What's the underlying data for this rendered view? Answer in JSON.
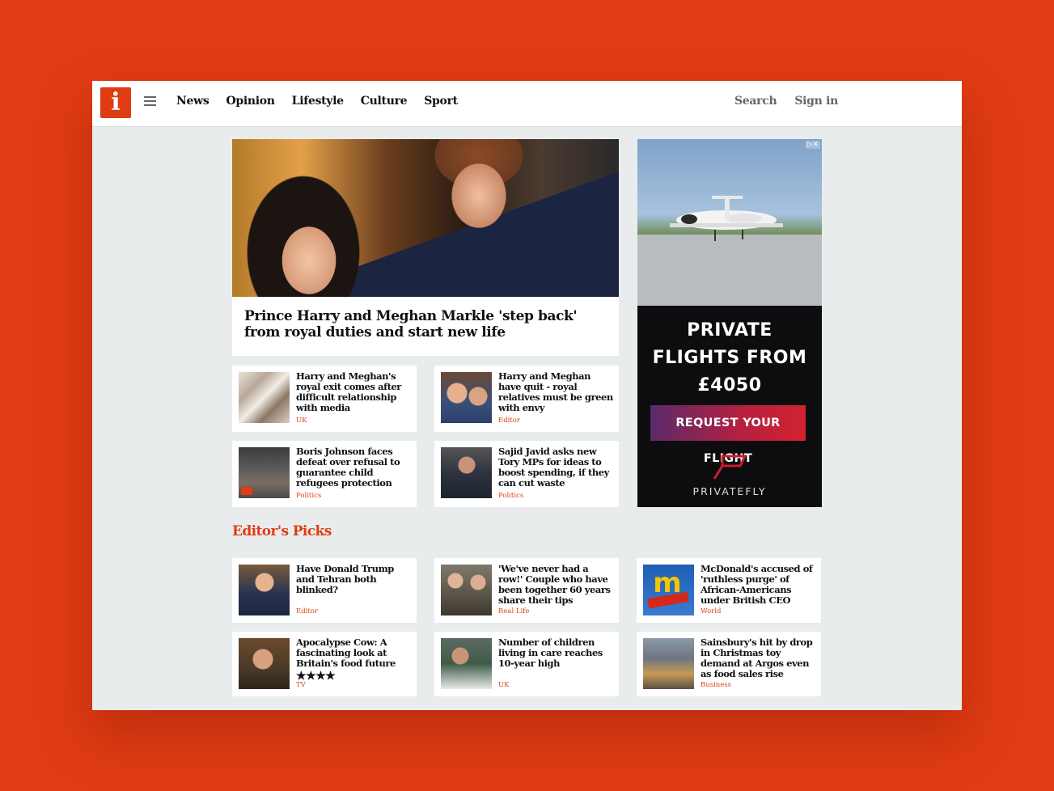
{
  "logo": "i",
  "nav": [
    "News",
    "Opinion",
    "Lifestyle",
    "Culture",
    "Sport"
  ],
  "topright": {
    "search": "Search",
    "signin": "Sign in"
  },
  "hero": {
    "title": "Prince Harry and Meghan Markle 'step back' from royal duties and start new life"
  },
  "stories": [
    {
      "title": "Harry and Meghan's royal exit comes after difficult relationship with media",
      "tag": "UK",
      "icon": "newspapers-thumbnail"
    },
    {
      "title": "Harry and Meghan have quit - royal relatives must be green with envy",
      "tag": "Editor",
      "icon": "royal-couple-thumbnail"
    },
    {
      "title": "Boris Johnson faces defeat over refusal to guarantee child refugees protection",
      "tag": "Politics",
      "icon": "protest-video-thumbnail"
    },
    {
      "title": "Sajid Javid asks new Tory MPs for ideas to boost spending, if they can cut waste",
      "tag": "Politics",
      "icon": "minister-thumbnail"
    }
  ],
  "ad": {
    "marks": "▷✕",
    "headline": [
      "PRIVATE",
      "FLIGHTS FROM",
      "£4050"
    ],
    "button": "REQUEST YOUR FLIGHT",
    "brand": "PRIVATEFLY"
  },
  "editors_picks": {
    "title": "Editor's Picks",
    "items": [
      {
        "title": "Have Donald Trump and Tehran both blinked?",
        "tag": "Editor"
      },
      {
        "title": "'We've never had a row!' Couple who have been together 60 years share their tips",
        "tag": "Real Life"
      },
      {
        "title": "McDonald's accused of 'ruthless purge' of African-Americans under British CEO",
        "tag": "World"
      },
      {
        "title": "Apocalypse Cow: A fascinating look at Britain's food future",
        "rating": "★★★★",
        "tag": "TV"
      },
      {
        "title": "Number of children living in care reaches 10-year high",
        "tag": "UK"
      },
      {
        "title": "Sainsbury's hit by drop in Christmas toy demand at Argos even as food sales rise",
        "tag": "Business"
      }
    ]
  },
  "colors": {
    "brand": "#e03c13",
    "background": "#e9eced"
  }
}
